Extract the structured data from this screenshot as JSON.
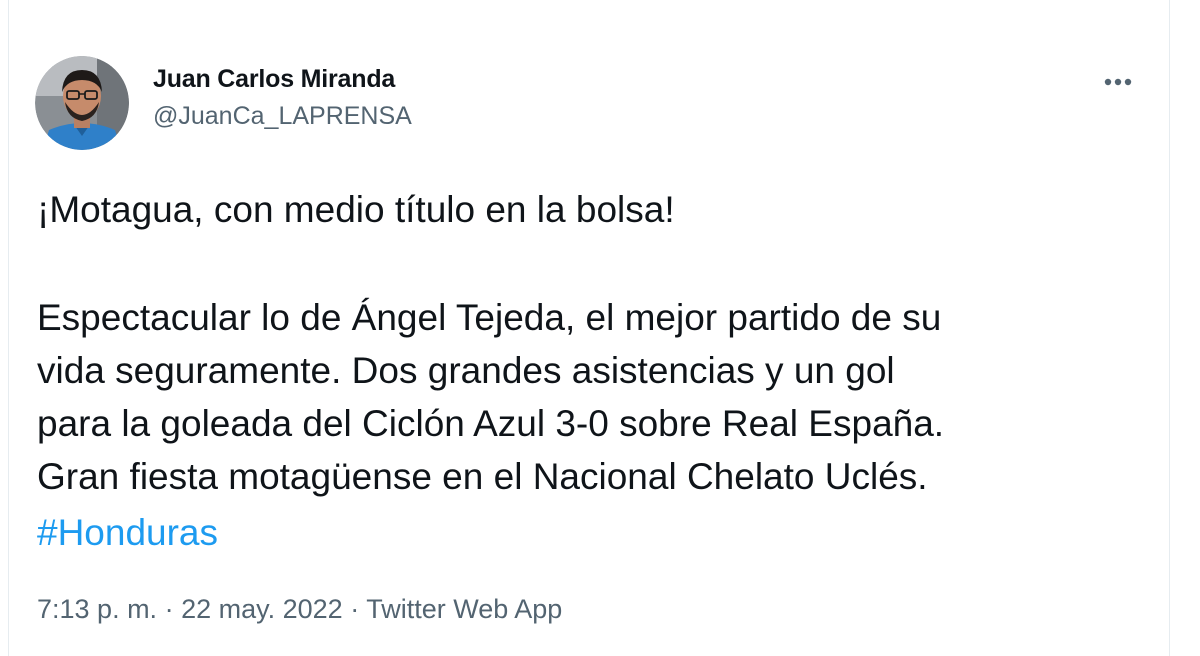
{
  "author": {
    "name": "Juan Carlos Miranda",
    "handle": "@JuanCa_LAPRENSA"
  },
  "more_icon": "more-horizontal-icon",
  "tweet": {
    "line1": "¡Motagua, con medio título en la bolsa!",
    "line2": "Espectacular lo de Ángel Tejeda, el mejor partido de su",
    "line3": "vida seguramente. Dos grandes asistencias y un gol",
    "line4": "para la goleada del Ciclón Azul 3-0 sobre Real España.",
    "line5": "Gran fiesta motagüense en el Nacional Chelato Uclés.",
    "hashtag": "#Honduras"
  },
  "meta": {
    "time": "7:13 p. m.",
    "sep1": " · ",
    "date": "22 may. 2022",
    "sep2": " · ",
    "source": "Twitter Web App"
  },
  "colors": {
    "text": "#0f1419",
    "secondary": "#536471",
    "link": "#1d9bf0"
  }
}
